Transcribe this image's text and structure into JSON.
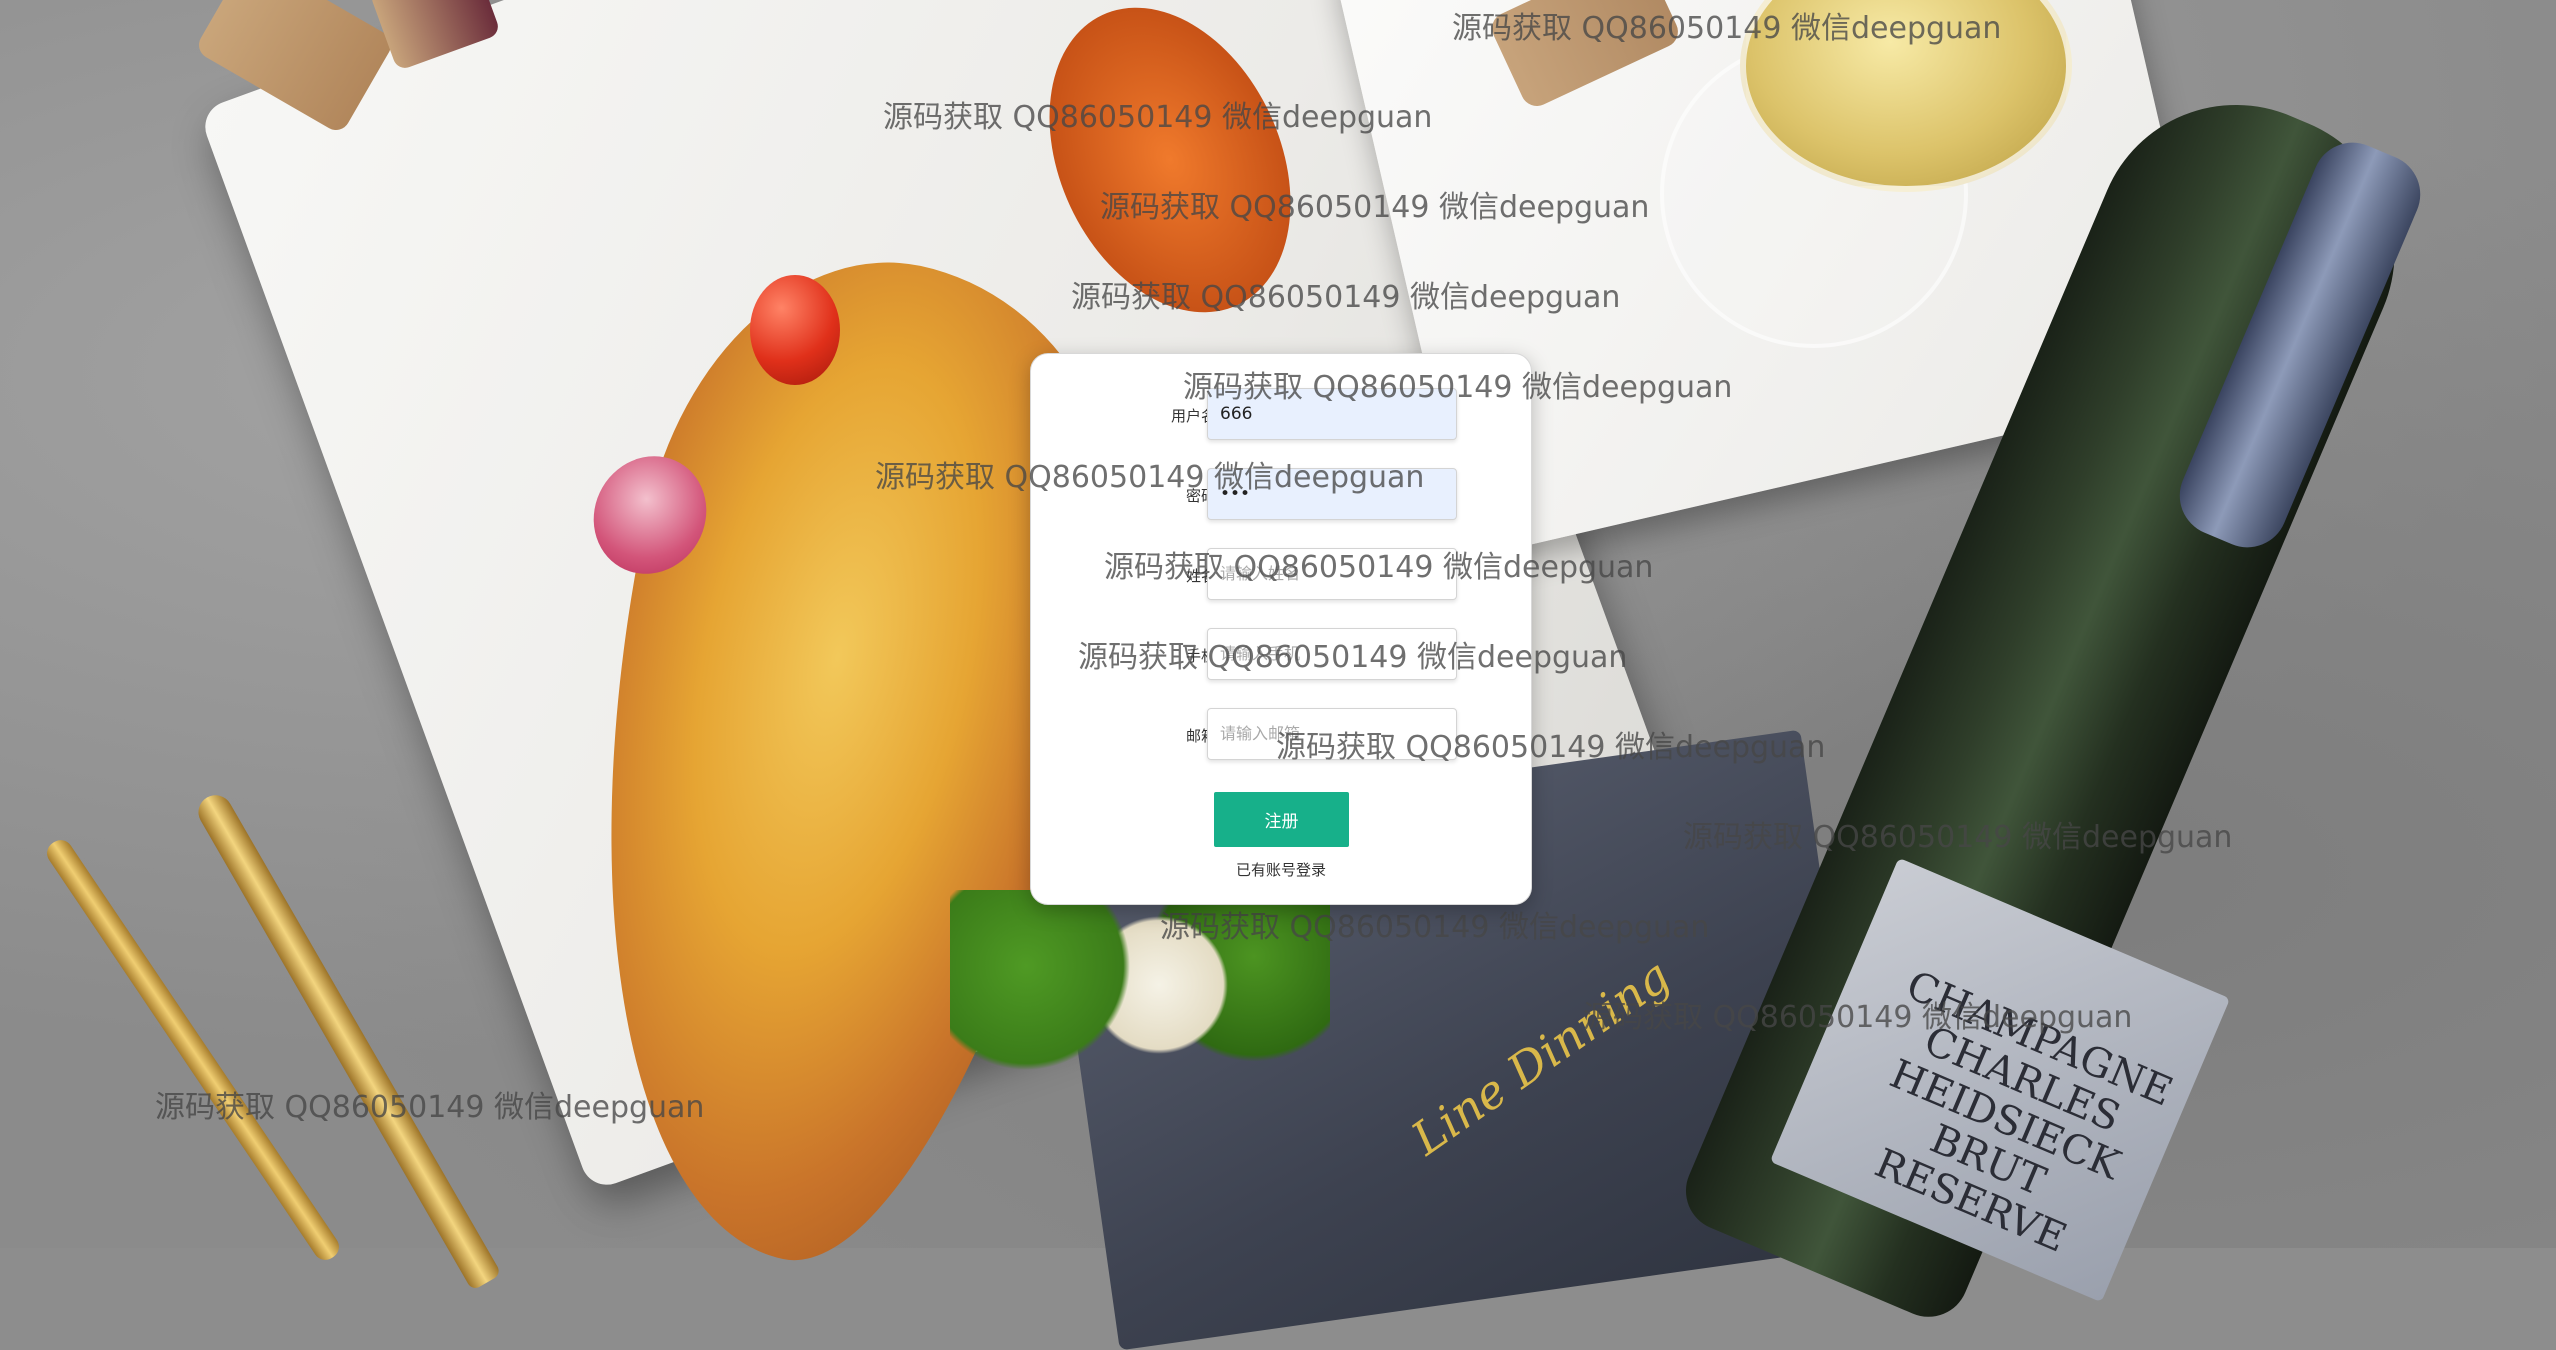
{
  "form": {
    "username": {
      "label": "用户名:",
      "value": "666",
      "placeholder": ""
    },
    "password": {
      "label": "密码:",
      "value": "666",
      "placeholder": ""
    },
    "name": {
      "label": "姓名:",
      "value": "",
      "placeholder": "请输入姓名"
    },
    "phone": {
      "label": "手机:",
      "value": "",
      "placeholder": "请输入手机"
    },
    "email": {
      "label": "邮箱:",
      "value": "",
      "placeholder": "请输入邮箱"
    },
    "submit_label": "注册",
    "login_link": "已有账号登录"
  },
  "background": {
    "napkin_logo": "Line Dinning",
    "bottle_label": "CHAMPAGNE CHARLES HEIDSIECK BRUT RESERVE"
  },
  "watermark": {
    "text": "源码获取 QQ86050149 微信deepguan"
  },
  "colors": {
    "primary_button": "#17b08a",
    "autofill_input": "#e8f0fe"
  }
}
